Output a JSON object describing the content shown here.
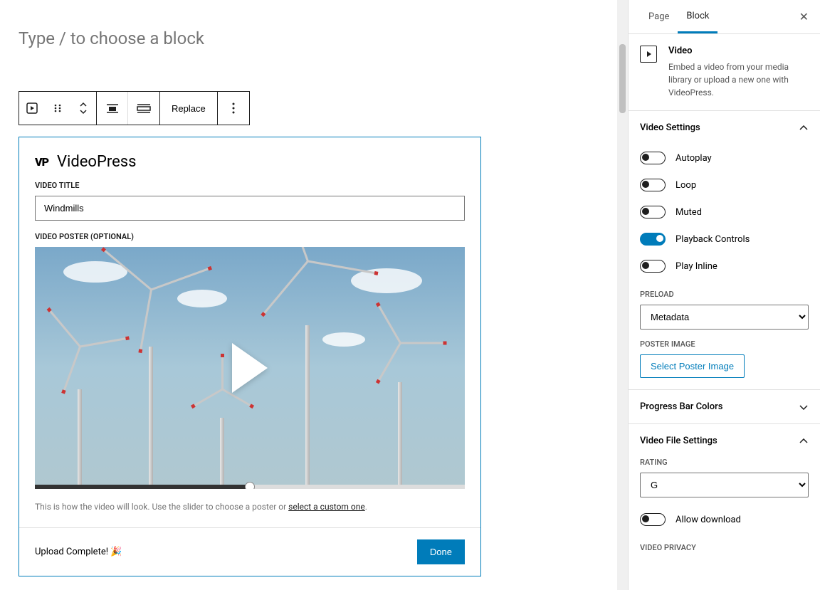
{
  "editor": {
    "placeholder_title": "Type / to choose a block",
    "toolbar": {
      "replace_label": "Replace"
    },
    "block": {
      "brand_mark": "VP",
      "brand_title": "VideoPress",
      "title_label": "VIDEO TITLE",
      "title_value": "Windmills",
      "poster_label": "VIDEO POSTER (OPTIONAL)",
      "poster_help": "This is how the video will look. Use the slider to choose a poster or ",
      "poster_help_link": "select a custom one",
      "upload_status": "Upload Complete! 🎉",
      "done_label": "Done"
    }
  },
  "sidebar": {
    "tabs": {
      "page": "Page",
      "block": "Block"
    },
    "block_info": {
      "title": "Video",
      "description": "Embed a video from your media library or upload a new one with VideoPress."
    },
    "panels": {
      "video_settings": {
        "title": "Video Settings",
        "autoplay": "Autoplay",
        "loop": "Loop",
        "muted": "Muted",
        "playback": "Playback Controls",
        "play_inline": "Play Inline",
        "preload_label": "PRELOAD",
        "preload_value": "Metadata",
        "poster_image_label": "POSTER IMAGE",
        "select_poster_btn": "Select Poster Image"
      },
      "progress_bar": "Progress Bar Colors",
      "video_file": {
        "title": "Video File Settings",
        "rating_label": "RATING",
        "rating_value": "G",
        "allow_download": "Allow download",
        "video_privacy_label": "VIDEO PRIVACY"
      }
    }
  }
}
